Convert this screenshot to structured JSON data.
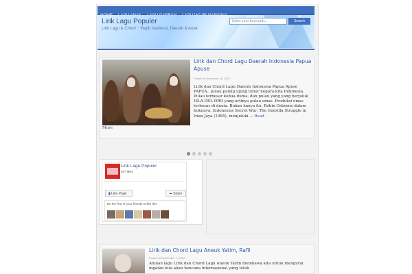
{
  "nav": {
    "items": [
      "HOME",
      "LAGU ANAK",
      "LAGU DAERAH",
      "LAGU WAJIB NASIONAL"
    ]
  },
  "header": {
    "title": "Lirik Lagu Populer",
    "tagline": "Lirik Lagu & Chord :: Wajib Nasional, Daerah & Anak",
    "search_placeholder": "Enter your keywords...",
    "search_button": "Search"
  },
  "featured": {
    "title": "Lirik dan Chord Lagu Daerah Indonesia Papua Apuse",
    "date": "Posted at November 16, 2012",
    "excerpt": "Lirik dan Chord Lagu Daerah Indonesia Papua Apuse PAPUA.. pulau paling ujung timur negara kita Indonesia. Pulau terbesar kedua dunia. dan pulau yang yang berjuluk ISLA DEL ORO yang artinya pulau emas. Produksi emas terbesar di dunia. Bukan hanya itu, Robin Osborne dalam bukunya, Indonesias Secret War: The Guerilla Struggle in Irian Jaya (1985), menjuluki ...",
    "read": "Read",
    "more": "More"
  },
  "slider": {
    "count": 5,
    "active": 0
  },
  "facebook": {
    "page_name": "Lirik Lagu Populer",
    "likes": "367 likes",
    "like_button": "Like Page",
    "share_button": "Share",
    "friends_text": "Be the first of your friends to like this",
    "avatar_colors": [
      "#7a6b5e",
      "#c9a27a",
      "#5a7aa8",
      "#d8c7a5",
      "#9c5a4a",
      "#b8b0a8",
      "#6b4e3a"
    ]
  },
  "post2": {
    "title": "Lirik dan Chord Lagu Aneuk Yatim, Rafli",
    "date": "Posted at September 7, 2013",
    "excerpt": "Alunan lagu Lirik dan Chord Lagu Aneuk Yatim membawa kita untuk mengurai ingatan kita akan bencana internasional yang telah"
  }
}
